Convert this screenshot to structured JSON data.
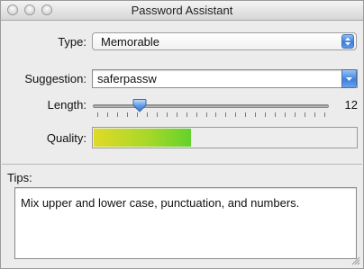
{
  "window": {
    "title": "Password Assistant"
  },
  "type_field": {
    "label": "Type:",
    "value": "Memorable"
  },
  "suggestion_field": {
    "label": "Suggestion:",
    "value": "saferpassw"
  },
  "length_field": {
    "label": "Length:",
    "value": "12",
    "level": 0.25
  },
  "quality_field": {
    "label": "Quality:",
    "level": 0.37
  },
  "tips": {
    "label": "Tips:",
    "text": "Mix upper and lower case, punctuation, and numbers."
  },
  "icons": [
    "close-icon",
    "minimize-icon",
    "zoom-icon",
    "popup-stepper-icon",
    "combo-arrow-icon",
    "slider-knob",
    "resize-grip-icon"
  ],
  "colors": {
    "accent_blue": "#3b7fde",
    "quality_start": "#e0da26",
    "quality_end": "#63d22b"
  }
}
